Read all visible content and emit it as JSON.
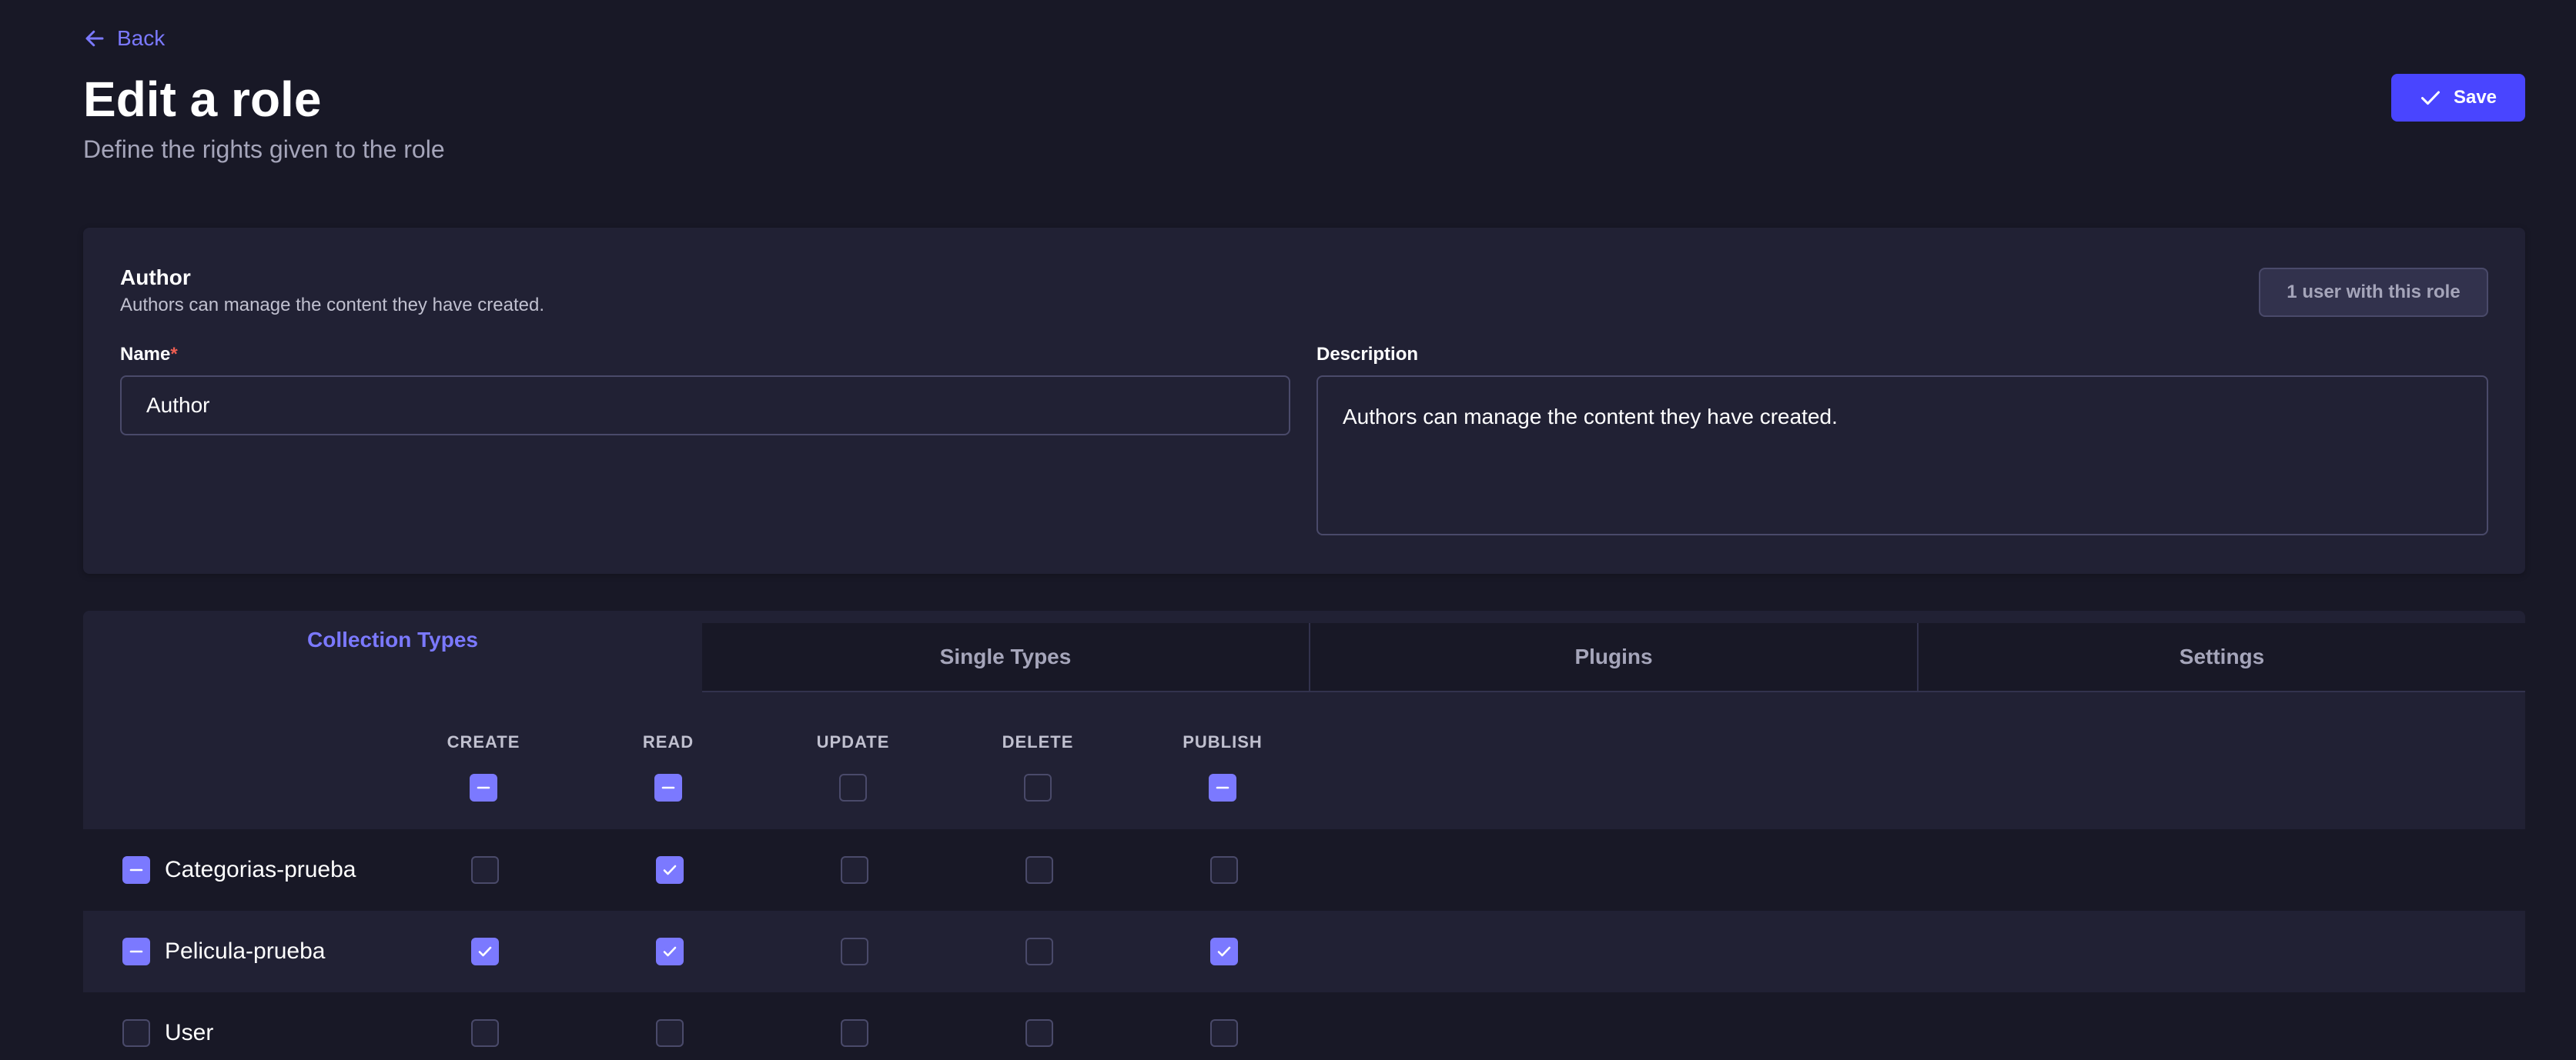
{
  "header": {
    "back_label": "Back",
    "title": "Edit a role",
    "subtitle": "Define the rights given to the role",
    "save_label": "Save"
  },
  "role": {
    "name": "Author",
    "description": "Authors can manage the content they have created.",
    "users_button": "1 user with this role",
    "name_label": "Name",
    "name_required_mark": "*",
    "name_value": "Author",
    "description_label": "Description",
    "description_value": "Authors can manage the content they have created."
  },
  "tabs": [
    {
      "label": "Collection Types",
      "active": true
    },
    {
      "label": "Single Types",
      "active": false
    },
    {
      "label": "Plugins",
      "active": false
    },
    {
      "label": "Settings",
      "active": false
    }
  ],
  "permissions": {
    "columns": [
      "CREATE",
      "READ",
      "UPDATE",
      "DELETE",
      "PUBLISH"
    ],
    "header_states": [
      "partial",
      "partial",
      "off",
      "off",
      "partial"
    ],
    "rows": [
      {
        "label": "Categorias-prueba",
        "row_state": "partial",
        "states": [
          "off",
          "checked",
          "off",
          "off",
          "off"
        ]
      },
      {
        "label": "Pelicula-prueba",
        "row_state": "partial",
        "states": [
          "checked",
          "checked",
          "off",
          "off",
          "checked"
        ]
      },
      {
        "label": "User",
        "row_state": "off",
        "states": [
          "off",
          "off",
          "off",
          "off",
          "off"
        ]
      }
    ]
  },
  "colors": {
    "accent": "#7b79ff",
    "primary_button": "#4945ff",
    "background": "#181826",
    "surface": "#212134",
    "required": "#ee5e52"
  },
  "icons": {
    "back": "arrow-left-icon",
    "save": "check-icon",
    "checked": "check-icon",
    "partial": "minus-icon"
  }
}
